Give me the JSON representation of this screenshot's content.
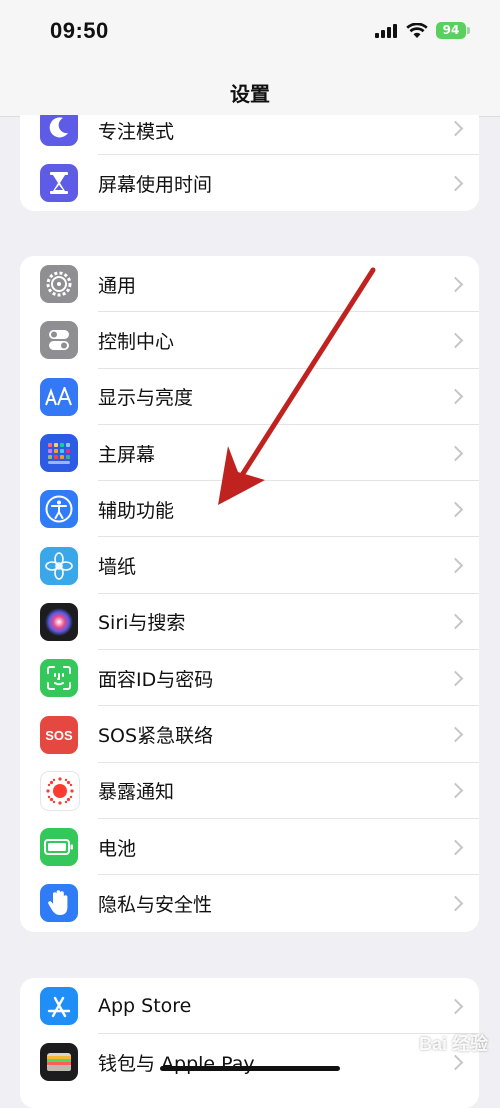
{
  "status": {
    "time": "09:50",
    "battery": "94"
  },
  "nav": {
    "title": "设置"
  },
  "groups": {
    "top": [
      {
        "label": "专注模式",
        "icon": "moon-icon",
        "color": "#5e5ce6"
      },
      {
        "label": "屏幕使用时间",
        "icon": "hourglass-icon",
        "color": "#5e5ce6"
      }
    ],
    "main": [
      {
        "label": "通用",
        "icon": "gear-icon",
        "color": "#8e8e93"
      },
      {
        "label": "控制中心",
        "icon": "toggles-icon",
        "color": "#8e8e93"
      },
      {
        "label": "显示与亮度",
        "icon": "text-size-icon",
        "color": "#3478f6"
      },
      {
        "label": "主屏幕",
        "icon": "home-screen-grid-icon",
        "color": "#2d5be3"
      },
      {
        "label": "辅助功能",
        "icon": "accessibility-icon",
        "color": "#2f7cf6"
      },
      {
        "label": "墙纸",
        "icon": "flower-icon",
        "color": "#39a7e8"
      },
      {
        "label": "Siri与搜索",
        "icon": "siri-icon",
        "color": "#1c1c1e"
      },
      {
        "label": "面容ID与密码",
        "icon": "face-id-icon",
        "color": "#34c759"
      },
      {
        "label": "SOS紧急联络",
        "icon": "sos-icon",
        "color": "#e54841"
      },
      {
        "label": "暴露通知",
        "icon": "exposure-icon",
        "color": "#ffffff"
      },
      {
        "label": "电池",
        "icon": "battery-icon",
        "color": "#34c759"
      },
      {
        "label": "隐私与安全性",
        "icon": "hand-icon",
        "color": "#2f7cf6"
      }
    ],
    "bottom": [
      {
        "label": "App Store",
        "icon": "app-store-icon",
        "color": "#1f8ff7"
      },
      {
        "label": "钱包与 Apple Pay",
        "icon": "wallet-icon",
        "color": "#1c1c1e"
      }
    ]
  },
  "overlay": {
    "annotation_arrow_color": "#c0221f"
  },
  "watermark": {
    "text": "Bai 经验"
  }
}
